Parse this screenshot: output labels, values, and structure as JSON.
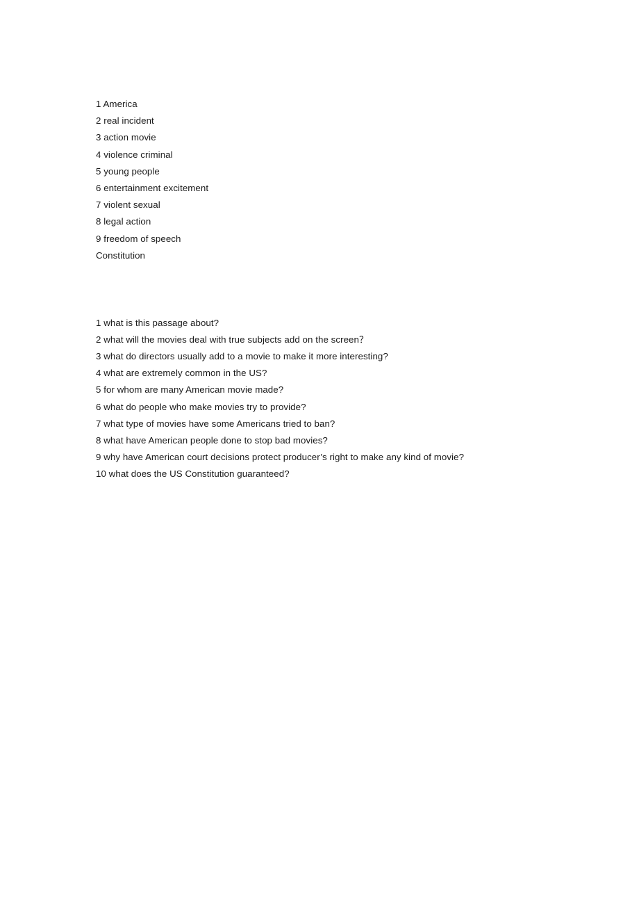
{
  "document": {
    "background_color": "#ffffff",
    "text_color": "#1a1a1a",
    "answers_section": {
      "lines": [
        "1 America",
        "2 real incident",
        "3 action movie",
        "4 violence criminal",
        "5 young people",
        "6 entertainment excitement",
        "7 violent sexual",
        "8 legal action",
        "9 freedom of speech",
        "Constitution"
      ]
    },
    "spacer": {
      "blank_line_count": 3
    },
    "questions_section": {
      "lines": [
        "1 what is this passage about?",
        "2 what will the movies deal with true subjects add on the screen？",
        "3 what do directors usually add to a movie to make it more interesting?",
        "4 what are extremely common in the US?",
        "5 for whom are many American movie made?",
        "6 what do people who make movies try to provide?",
        "7 what type of movies have some Americans tried to ban?",
        "8 what have American people done to stop bad movies?",
        "9 why have American court decisions protect producer’s right to make any kind of movie?",
        "10 what does the US Constitution guaranteed?"
      ]
    }
  }
}
